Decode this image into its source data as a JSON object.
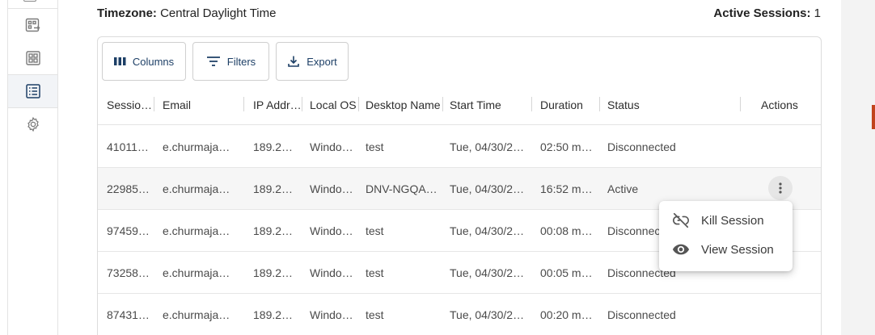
{
  "header": {
    "timezone_label": "Timezone:",
    "timezone_value": "Central Daylight Time",
    "active_sessions_label": "Active Sessions:",
    "active_sessions_value": "1"
  },
  "sidebar": {
    "items": [
      {
        "icon": "launch-app-icon",
        "active": false
      },
      {
        "icon": "dashboard-grid-icon",
        "active": false
      },
      {
        "icon": "sessions-list-icon",
        "active": true
      },
      {
        "icon": "gear-icon",
        "active": false
      }
    ]
  },
  "toolbar": {
    "columns_label": "Columns",
    "filters_label": "Filters",
    "export_label": "Export"
  },
  "table": {
    "columns": [
      "Sessio…",
      "Email",
      "IP Addr…",
      "Local OS",
      "Desktop Name",
      "Start Time",
      "Duration",
      "Status",
      "Actions"
    ],
    "rows": [
      [
        "41011…",
        "e.churmaja…",
        "189.2…",
        "Windo…",
        "test",
        "Tue, 04/30/2…",
        "02:50 m…",
        "Disconnected"
      ],
      [
        "22985…",
        "e.churmaja…",
        "189.2…",
        "Windo…",
        "DNV-NGQA…",
        "Tue, 04/30/2…",
        "16:52 m…",
        "Active"
      ],
      [
        "97459…",
        "e.churmaja…",
        "189.2…",
        "Windo…",
        "test",
        "Tue, 04/30/2…",
        "00:08 m…",
        "Disconnected"
      ],
      [
        "73258…",
        "e.churmaja…",
        "189.2…",
        "Windo…",
        "test",
        "Tue, 04/30/2…",
        "00:05 m…",
        "Disconnected"
      ],
      [
        "87431…",
        "e.churmaja…",
        "189.2…",
        "Windo…",
        "test",
        "Tue, 04/30/2…",
        "00:20 m…",
        "Disconnected"
      ]
    ]
  },
  "actions_menu": {
    "items": [
      {
        "label": "Kill Session",
        "icon": "link-off-icon"
      },
      {
        "label": "View Session",
        "icon": "eye-icon"
      }
    ]
  },
  "colors": {
    "accent": "#1d3f66",
    "border": "#dcdcdc",
    "highlight_row": "#f6f6f6"
  }
}
